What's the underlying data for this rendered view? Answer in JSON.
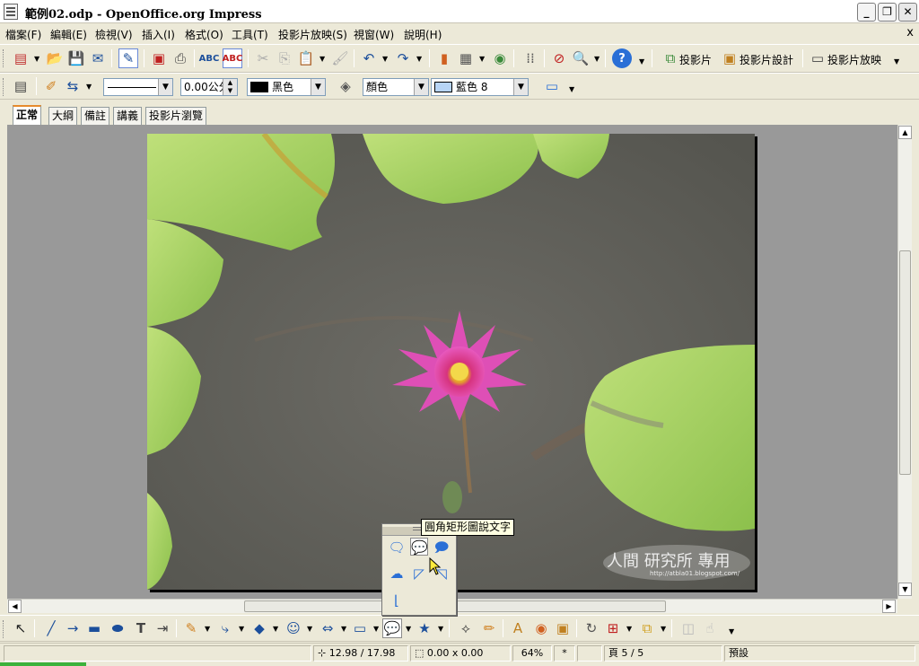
{
  "window": {
    "title": "範例02.odp - OpenOffice.org Impress",
    "buttons": [
      "_",
      "❐",
      "✕"
    ]
  },
  "menu": {
    "items": [
      "檔案(F)",
      "編輯(E)",
      "檢視(V)",
      "插入(I)",
      "格式(O)",
      "工具(T)",
      "投影片放映(S)",
      "視窗(W)",
      "說明(H)"
    ],
    "close": "x"
  },
  "toolbar_standard": {
    "slide_button": "投影片",
    "slide_design_button": "投影片設計",
    "slideshow_button": "投影片放映"
  },
  "toolbar_line_fill": {
    "line_width": "0.00公分",
    "line_color": "黑色",
    "line_color_hex": "#000000",
    "area_style": "顏色",
    "area_color": "藍色 8",
    "area_color_hex": "#b7d4f5"
  },
  "tabs": [
    "正常",
    "大綱",
    "備註",
    "講義",
    "投影片瀏覽"
  ],
  "active_tab": "正常",
  "slide": {
    "watermark_main": "人間 研究所 專用",
    "watermark_url": "http://atbla01.blogspot.com/"
  },
  "callout_popup": {
    "tooltip": "圓角矩形圖說文字"
  },
  "status": {
    "position": "12.98 / 17.98",
    "size": "0.00 x 0.00",
    "zoom": "64%",
    "modified": "*",
    "page": "頁 5 / 5",
    "layout": "預設"
  }
}
